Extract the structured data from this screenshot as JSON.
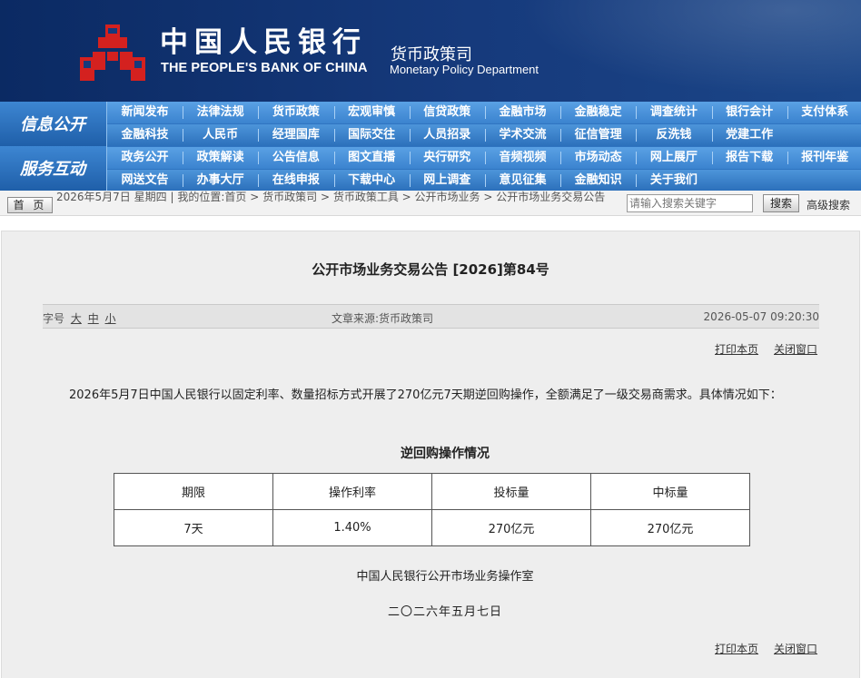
{
  "header": {
    "bank_name_cn": "中国人民银行",
    "bank_name_en": "THE PEOPLE'S BANK OF CHINA",
    "dept_cn": "货币政策司",
    "dept_en": "Monetary Policy Department",
    "brand_color": "#163a7c",
    "logo_color": "#d4211f"
  },
  "nav": {
    "side_label_1": "信息公开",
    "side_label_2": "服务互动",
    "row1": [
      "新闻发布",
      "法律法规",
      "货币政策",
      "宏观审慎",
      "信贷政策",
      "金融市场",
      "金融稳定",
      "调查统计",
      "银行会计",
      "支付体系"
    ],
    "row2": [
      "金融科技",
      "人民币",
      "经理国库",
      "国际交往",
      "人员招录",
      "学术交流",
      "征信管理",
      "反洗钱",
      "党建工作"
    ],
    "row3": [
      "政务公开",
      "政策解读",
      "公告信息",
      "图文直播",
      "央行研究",
      "音频视频",
      "市场动态",
      "网上展厅",
      "报告下载",
      "报刊年鉴"
    ],
    "row4": [
      "网送文告",
      "办事大厅",
      "在线申报",
      "下载中心",
      "网上调查",
      "意见征集",
      "金融知识",
      "关于我们"
    ]
  },
  "breadcrumb": {
    "home": "首 页",
    "date": "2026年5月7日 星期四",
    "sep": "|",
    "location_label": "我的位置:",
    "items": [
      "首页",
      "货币政策司",
      "货币政策工具",
      "公开市场业务",
      "公开市场业务交易公告"
    ],
    "search_placeholder": "请输入搜索关键字",
    "search_button": "搜索",
    "advanced_search": "高级搜索"
  },
  "article": {
    "title": "公开市场业务交易公告 [2026]第84号",
    "font_size_label": "字号",
    "font_sizes": [
      "大",
      "中",
      "小"
    ],
    "source": "文章来源:货币政策司",
    "timestamp": "2026-05-07 09:20:30",
    "print_link": "打印本页",
    "close_link": "关闭窗口",
    "body": "2026年5月7日中国人民银行以固定利率、数量招标方式开展了270亿元7天期逆回购操作，全额满足了一级交易商需求。具体情况如下：",
    "table_title": "逆回购操作情况",
    "table_headers": [
      "期限",
      "操作利率",
      "投标量",
      "中标量"
    ],
    "table_row": [
      "7天",
      "1.40%",
      "270亿元",
      "270亿元"
    ],
    "signature": "中国人民银行公开市场业务操作室",
    "date": "二〇二六年五月七日"
  }
}
